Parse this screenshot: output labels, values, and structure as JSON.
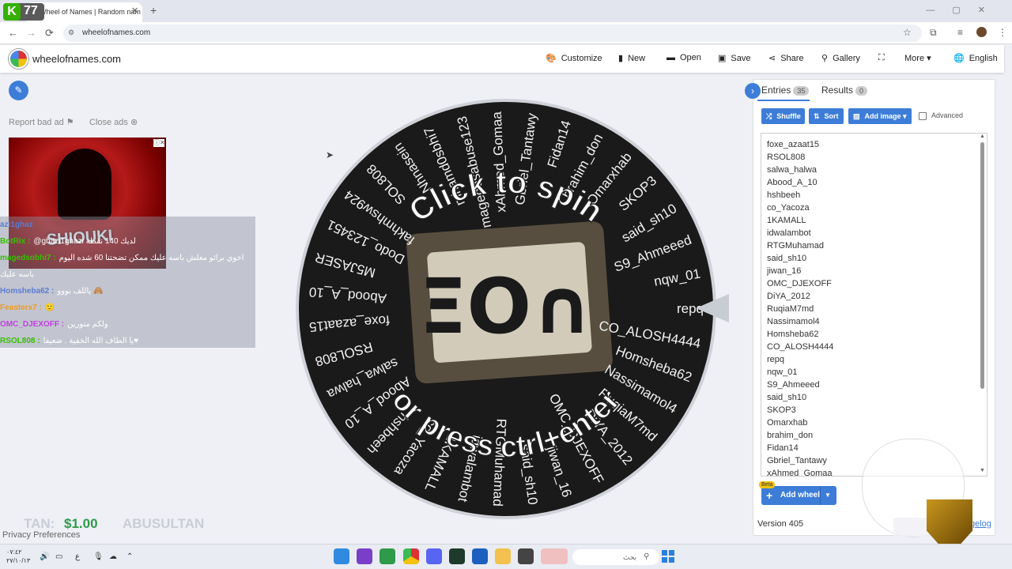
{
  "browser": {
    "tab_title": "Wheel of Names | Random nam",
    "tab_close": "✕",
    "new_tab": "+",
    "overlay_badge_letter": "K",
    "overlay_badge_number": "77",
    "url": "wheelofnames.com",
    "nav_back": "←",
    "nav_forward": "→",
    "nav_reload": "⟳",
    "window_controls": "—▢✕"
  },
  "header": {
    "brand": "wheelofnames.com",
    "menu": [
      {
        "icon": "palette-icon",
        "glyph": "🎨",
        "label": "Customize"
      },
      {
        "icon": "new-file-icon",
        "glyph": "▮",
        "label": "New"
      },
      {
        "icon": "folder-icon",
        "glyph": "▬",
        "label": "Open"
      },
      {
        "icon": "save-icon",
        "glyph": "▣",
        "label": "Save"
      },
      {
        "icon": "share-icon",
        "glyph": "⋖",
        "label": "Share"
      },
      {
        "icon": "search-icon",
        "glyph": "⚲",
        "label": "Gallery"
      },
      {
        "icon": "fullscreen-icon",
        "glyph": "⛶",
        "label": ""
      },
      {
        "icon": "chevron-down-icon",
        "glyph": "▾",
        "label": "More"
      },
      {
        "icon": "globe-icon",
        "glyph": "🌐",
        "label": "English"
      }
    ]
  },
  "left": {
    "edit_glyph": "✎",
    "report_ad": "Report bad ad",
    "close_ads": "Close ads",
    "ad_text": "SHIOUKI",
    "ad_close": "ⓘ✕",
    "chat": [
      {
        "user": "azi1ghaz",
        "msg": "",
        "color": "#5b7bd5"
      },
      {
        "user": "BotRix :",
        "msg": "@ghazi1ghazi لديك 140 نقطة",
        "color": "#35c000"
      },
      {
        "user": "magedsobhi7 :",
        "msg": "اخوي برائو معلش باسه عليك ممكن تضحتنا 60 شده اليوم",
        "color": "#35c000"
      },
      {
        "user": "",
        "msg": "باسه عليك",
        "color": "#35c000"
      },
      {
        "user": "Homsheba62 :",
        "msg": "ياللف بووو 🙈",
        "color": "#5b7bd5"
      },
      {
        "user": "Feasterx7 :",
        "msg": "🙂",
        "color": "#f09a20"
      },
      {
        "user": "OMC_DJEXOFF :",
        "msg": "ولكم منورين",
        "color": "#c040e0"
      },
      {
        "user": "RSOL808 :",
        "msg": "يا الطاف الله الخفية . ضعيفا♥",
        "color": "#35c000"
      }
    ],
    "tip_prefix": "TAN:",
    "tip_amount": "$1.00",
    "tip_user": "ABUSULTAN",
    "privacy": "Privacy Preferences"
  },
  "wheel": {
    "center_text": "ΞO∩",
    "top_text": "Click to spin",
    "bottom_text": "or press ctrl+enter",
    "pointer_color": "#c8ccd3",
    "labels": [
      "repq",
      "CO_ALOSH4444",
      "Homsheba62",
      "Nassimamol4",
      "RuqiaM7md",
      "DiYA_2012",
      "OMC_DJEXOFF",
      "jiwan_16",
      "said_sh10",
      "RTGMuhamad",
      "idwalambot",
      "1KAMALL",
      "co_Yacoza",
      "hshbeeh",
      "Abood_A_10",
      "salwa_halwa",
      "RSOL808",
      "foxe_azaat15",
      "Abood_A_10",
      "M5JASER",
      "Dodo_123451",
      "fakhmhsw924",
      "SOL808",
      "Nhnasein",
      "mhamd0sbhi7",
      "magedosabuse123",
      "xAhmed_Gomaa",
      "Gbriel_Tantawy",
      "Fidan14",
      "brahim_don",
      "Omarxhab",
      "SKOP3",
      "said_sh10",
      "S9_Ahmeeed",
      "nqw_01"
    ]
  },
  "panel": {
    "toggle_glyph": "›",
    "entries_tab": "Entries",
    "entries_count": "35",
    "results_tab": "Results",
    "results_count": "0",
    "shuffle": "Shuffle",
    "sort": "Sort",
    "add_image": "Add image",
    "advanced": "Advanced",
    "entries": [
      "foxe_azaat15",
      "RSOL808",
      "salwa_halwa",
      "Abood_A_10",
      "hshbeeh",
      "co_Yacoza",
      "1KAMALL",
      "idwalambot",
      "RTGMuhamad",
      "said_sh10",
      "jiwan_16",
      "OMC_DJEXOFF",
      "DiYA_2012",
      "RuqiaM7md",
      "Nassimamol4",
      "Homsheba62",
      "CO_ALOSH4444",
      "repq",
      "nqw_01",
      "S9_Ahmeeed",
      "said_sh10",
      "SKOP3",
      "Omarxhab",
      "brahim_don",
      "Fidan14",
      "Gbriel_Tantawy",
      "xAhmed_Gomaa"
    ],
    "beta": "Beta",
    "add_wheel": "Add wheel",
    "version": "Version 405",
    "changelog": "gelog"
  },
  "taskbar": {
    "search": "بحث",
    "time": "٠٧:٤٢",
    "date": "٢٧/١٠/١٣",
    "lang": "ع"
  }
}
